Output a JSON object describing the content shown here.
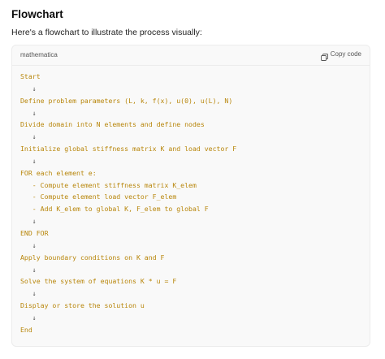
{
  "heading": "Flowchart",
  "intro": "Here's a flowchart to illustrate the process visually:",
  "code_block": {
    "language": "mathematica",
    "copy_label": "Copy code",
    "lines": [
      "Start",
      "   ↓",
      "Define problem parameters (L, k, f(x), u(0), u(L), N)",
      "   ↓",
      "Divide domain into N elements and define nodes",
      "   ↓",
      "Initialize global stiffness matrix K and load vector F",
      "   ↓",
      "FOR each element e:",
      "   - Compute element stiffness matrix K_elem",
      "   - Compute element load vector F_elem",
      "   - Add K_elem to global K, F_elem to global F",
      "   ↓",
      "END FOR",
      "   ↓",
      "Apply boundary conditions on K and F",
      "   ↓",
      "Solve the system of equations K * u = F",
      "   ↓",
      "Display or store the solution u",
      "   ↓",
      "End"
    ]
  },
  "icons": {
    "copy": "copy-icon"
  },
  "colors": {
    "code_text": "#b8860b",
    "arrow": "#555555",
    "code_bg": "#f9f9f9"
  }
}
